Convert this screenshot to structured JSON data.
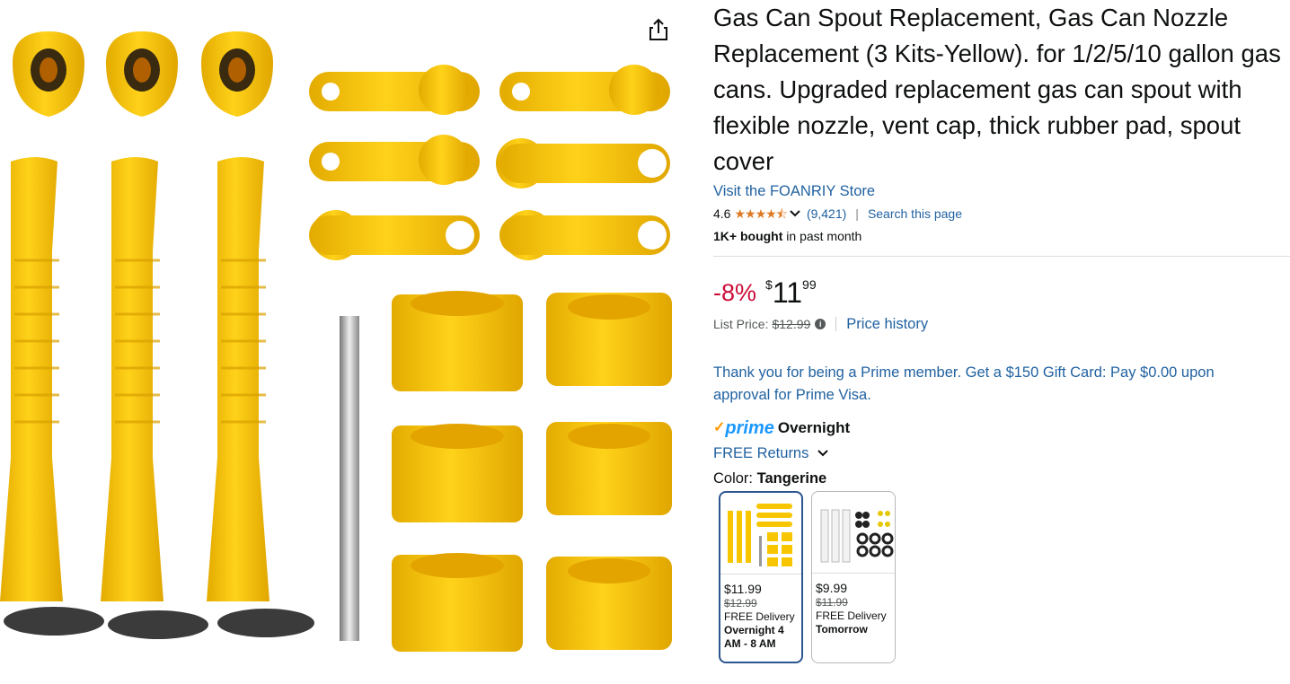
{
  "product": {
    "title": "Gas Can Spout Replacement, Gas Can Nozzle Replacement (3 Kits-Yellow). for 1/2/5/10 gallon gas cans. Upgraded replacement gas can spout with flexible nozzle, vent cap, thick rubber pad, spout cover",
    "store_link": "Visit the FOANRIY Store",
    "rating": "4.6",
    "stars_display": "★★★★⯪",
    "rating_count": "(9,421)",
    "search_link": "Search this page",
    "bought_bold": "1K+ bought",
    "bought_rest": " in past month"
  },
  "pricing": {
    "discount": "-8%",
    "currency": "$",
    "whole": "11",
    "fraction": "99",
    "list_label": "List Price:",
    "list_value": "$12.99",
    "price_history": "Price history"
  },
  "prime_message": "Thank you for being a Prime member. Get a $150 Gift Card: Pay $0.00 upon approval for Prime Visa.",
  "delivery": {
    "prime_word": "prime",
    "speed": "Overnight",
    "returns": "FREE Returns"
  },
  "color": {
    "label": "Color: ",
    "value": "Tangerine",
    "options": [
      {
        "price": "$11.99",
        "list": "$12.99",
        "delivery_line1": "FREE Delivery",
        "delivery_bold": "Overnight 4 AM - 8 AM",
        "selected": true
      },
      {
        "price": "$9.99",
        "list": "$11.99",
        "delivery_line1": "FREE Delivery",
        "delivery_bold": "Tomorrow",
        "selected": false
      }
    ]
  },
  "colors": {
    "link": "#2162a1",
    "discount": "#cc0c39",
    "star": "#de7921",
    "product_yellow": "#f7c600",
    "selected_border": "#2d5590"
  }
}
